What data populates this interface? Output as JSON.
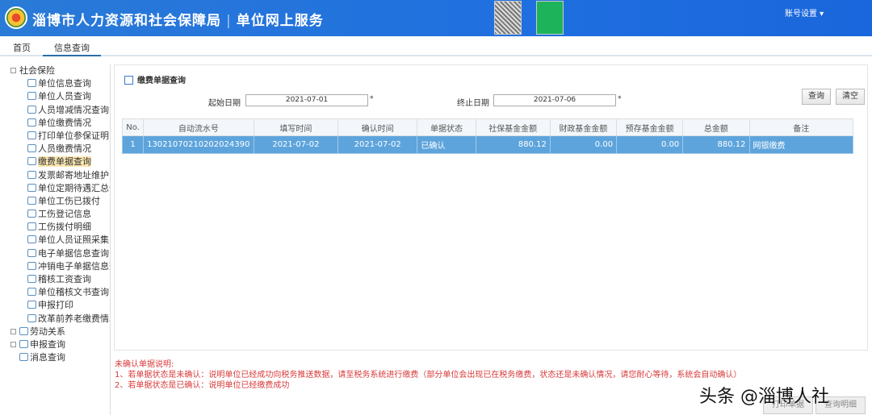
{
  "header": {
    "title": "淄博市人力资源和社会保障局",
    "subtitle": "单位网上服务",
    "account": "账号设置 ▾"
  },
  "tabs": [
    {
      "label": "首页"
    },
    {
      "label": "信息查询"
    }
  ],
  "sidebar": {
    "root": "社会保险",
    "items": [
      "单位信息查询",
      "单位人员查询",
      "人员增减情况查询",
      "单位缴费情况",
      "打印单位参保证明",
      "人员缴费情况",
      "缴费单据查询",
      "发票邮寄地址维护",
      "单位定期待遇汇总信息",
      "单位工伤已拨付",
      "工伤登记信息",
      "工伤拨付明细",
      "单位人员证照采集",
      "电子单据信息查询",
      "冲销电子单据信息查询",
      "稽核工资查询",
      "单位稽核文书查询",
      "申报打印",
      "改革前养老缴费情况"
    ],
    "others": [
      "劳动关系",
      "申报查询",
      "消息查询"
    ]
  },
  "panel": {
    "title": "缴费单据查询",
    "start_label": "起始日期",
    "start_value": "2021-07-01",
    "end_label": "终止日期",
    "end_value": "2021-07-06",
    "required": "*",
    "query": "查询",
    "clear": "清空"
  },
  "table": {
    "headers": [
      "No.",
      "自动流水号",
      "填写时间",
      "确认时间",
      "单据状态",
      "社保基金金额",
      "财政基金金额",
      "预存基金金额",
      "总金额",
      "备注"
    ],
    "rows": [
      [
        "1",
        "13021070210202024390",
        "2021-07-02",
        "2021-07-02",
        "已确认",
        "880.12",
        "0.00",
        "0.00",
        "880.12",
        "网银缴费"
      ]
    ]
  },
  "notes": [
    "未确认单据说明:",
    "1、若单据状态是未确认：说明单位已经成功向税务推送数据，请至税务系统进行缴费（部分单位会出现已在税务缴费，状态还是未确认情况，请您耐心等待，系统会自动确认）",
    "2、若单据状态是已确认：说明单位已经缴费成功"
  ],
  "bottom_buttons": [
    "打印单据",
    "查询明细"
  ],
  "watermark": "头条 @淄博人社"
}
